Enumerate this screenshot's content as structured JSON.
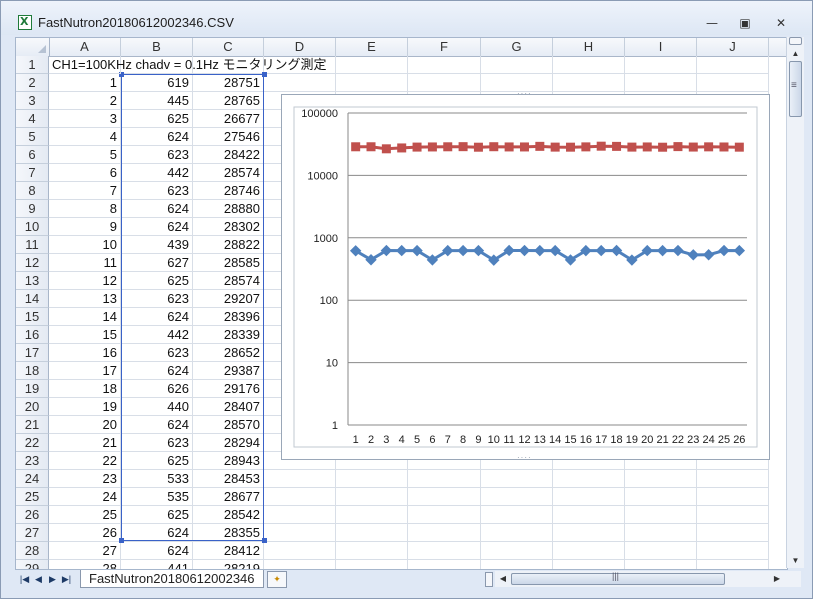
{
  "window": {
    "title": "FastNutron20180612002346.CSV",
    "minimize_glyph": "—",
    "maximize_glyph": "▣",
    "close_glyph": "✕",
    "app_icon": "excel-icon"
  },
  "columns": [
    "A",
    "B",
    "C",
    "D",
    "E",
    "F",
    "G",
    "H",
    "I",
    "J"
  ],
  "row1_text": "CH1=100KHz  chadv = 0.1Hz モニタリング測定",
  "rows": [
    {
      "n": "1"
    },
    {
      "n": "2",
      "a": "1",
      "b": "619",
      "c": "28751"
    },
    {
      "n": "3",
      "a": "2",
      "b": "445",
      "c": "28765"
    },
    {
      "n": "4",
      "a": "3",
      "b": "625",
      "c": "26677"
    },
    {
      "n": "5",
      "a": "4",
      "b": "624",
      "c": "27546"
    },
    {
      "n": "6",
      "a": "5",
      "b": "623",
      "c": "28422"
    },
    {
      "n": "7",
      "a": "6",
      "b": "442",
      "c": "28574"
    },
    {
      "n": "8",
      "a": "7",
      "b": "623",
      "c": "28746"
    },
    {
      "n": "9",
      "a": "8",
      "b": "624",
      "c": "28880"
    },
    {
      "n": "10",
      "a": "9",
      "b": "624",
      "c": "28302"
    },
    {
      "n": "11",
      "a": "10",
      "b": "439",
      "c": "28822"
    },
    {
      "n": "12",
      "a": "11",
      "b": "627",
      "c": "28585"
    },
    {
      "n": "13",
      "a": "12",
      "b": "625",
      "c": "28574"
    },
    {
      "n": "14",
      "a": "13",
      "b": "623",
      "c": "29207"
    },
    {
      "n": "15",
      "a": "14",
      "b": "624",
      "c": "28396"
    },
    {
      "n": "16",
      "a": "15",
      "b": "442",
      "c": "28339"
    },
    {
      "n": "17",
      "a": "16",
      "b": "623",
      "c": "28652"
    },
    {
      "n": "18",
      "a": "17",
      "b": "624",
      "c": "29387"
    },
    {
      "n": "19",
      "a": "18",
      "b": "626",
      "c": "29176"
    },
    {
      "n": "20",
      "a": "19",
      "b": "440",
      "c": "28407"
    },
    {
      "n": "21",
      "a": "20",
      "b": "624",
      "c": "28570"
    },
    {
      "n": "22",
      "a": "21",
      "b": "623",
      "c": "28294"
    },
    {
      "n": "23",
      "a": "22",
      "b": "625",
      "c": "28943"
    },
    {
      "n": "24",
      "a": "23",
      "b": "533",
      "c": "28453"
    },
    {
      "n": "25",
      "a": "24",
      "b": "535",
      "c": "28677"
    },
    {
      "n": "26",
      "a": "25",
      "b": "625",
      "c": "28542"
    },
    {
      "n": "27",
      "a": "26",
      "b": "624",
      "c": "28355"
    },
    {
      "n": "28",
      "a": "27",
      "b": "624",
      "c": "28412"
    },
    {
      "n": "29",
      "a": "28",
      "b": "441",
      "c": "28219"
    }
  ],
  "sheet_tab": "FastNutron20180612002346",
  "chart_data": {
    "type": "line",
    "title": "",
    "xlabel": "",
    "ylabel": "",
    "y_scale": "log",
    "ylim": [
      1,
      100000
    ],
    "y_ticks": [
      "1",
      "10",
      "100",
      "1000",
      "10000",
      "100000"
    ],
    "categories": [
      "1",
      "2",
      "3",
      "4",
      "5",
      "6",
      "7",
      "8",
      "9",
      "10",
      "11",
      "12",
      "13",
      "14",
      "15",
      "16",
      "17",
      "18",
      "19",
      "20",
      "21",
      "22",
      "23",
      "24",
      "25",
      "26"
    ],
    "grid": true,
    "legend": "none",
    "series": [
      {
        "color": "#4f81bd",
        "marker": "diamond",
        "values": [
          619,
          445,
          625,
          624,
          623,
          442,
          623,
          624,
          624,
          439,
          627,
          625,
          623,
          624,
          442,
          623,
          624,
          626,
          440,
          624,
          623,
          625,
          533,
          535,
          625,
          624
        ]
      },
      {
        "color": "#c0504d",
        "marker": "square",
        "values": [
          28751,
          28765,
          26677,
          27546,
          28422,
          28574,
          28746,
          28880,
          28302,
          28822,
          28585,
          28574,
          29207,
          28396,
          28339,
          28652,
          29387,
          29176,
          28407,
          28570,
          28294,
          28943,
          28453,
          28677,
          28542,
          28355
        ]
      }
    ]
  }
}
